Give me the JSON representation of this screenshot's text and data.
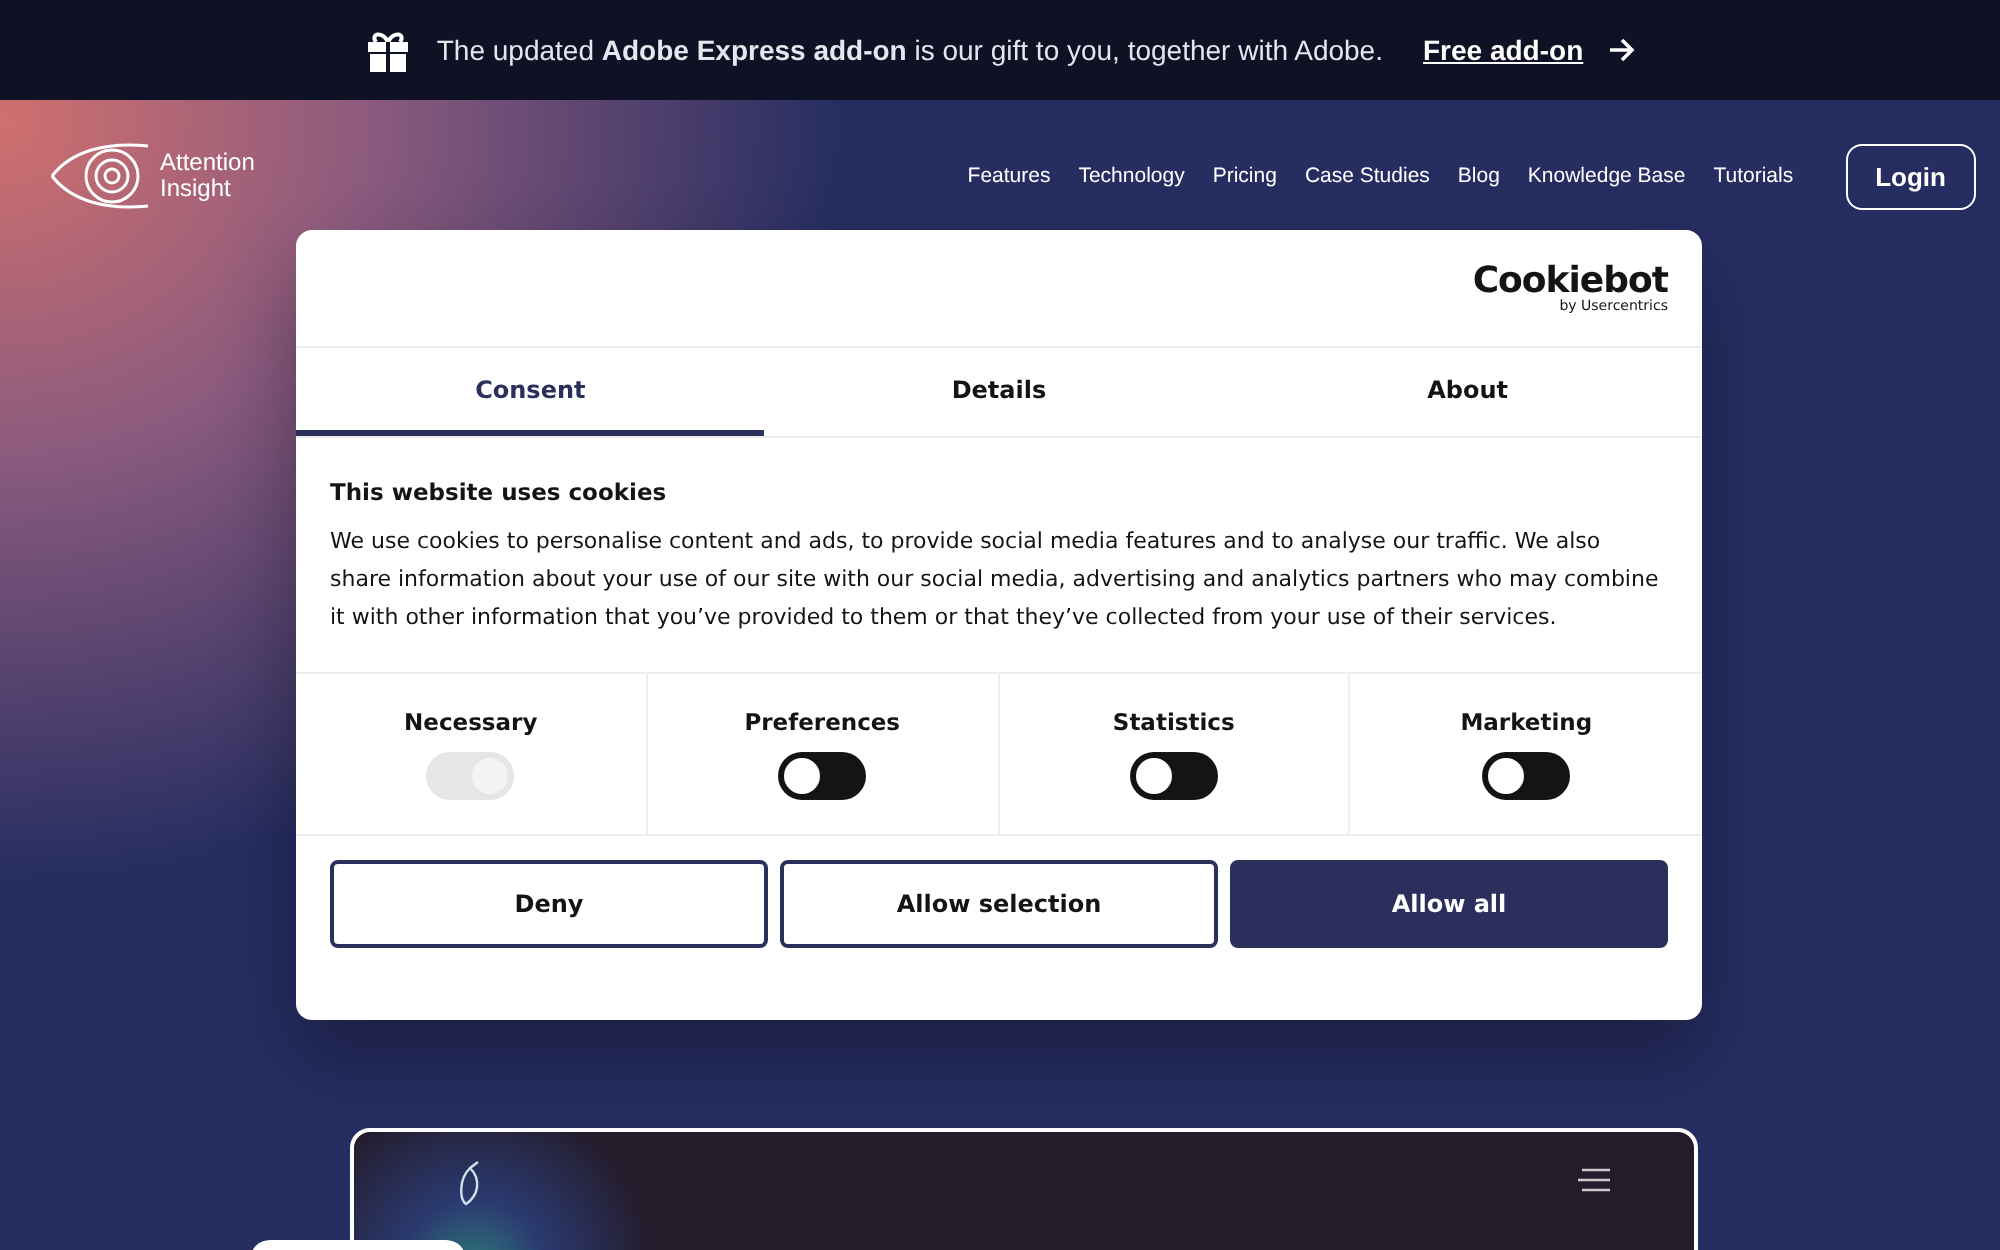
{
  "banner": {
    "text": "The updated **Adobe Express add-on** is our gift to you, together with Adobe.",
    "link": "Free add-on"
  },
  "header": {
    "logo": "Attention Insight",
    "nav": [
      "Features",
      "Technology",
      "Pricing",
      "Case Studies",
      "Blog",
      "Knowledge Base",
      "Tutorials"
    ],
    "login": "Login"
  },
  "cookie_dialog": {
    "brand": "Cookiebot",
    "brand_sub": "by Usercentrics",
    "tabs": [
      {
        "label": "Consent",
        "selected": true
      },
      {
        "label": "Details",
        "selected": false
      },
      {
        "label": "About",
        "selected": false
      }
    ],
    "title": "This website uses cookies",
    "body": "We use cookies to personalise content and ads, to provide social media features and to analyse our traffic. We also share information about your use of our site with our social media, advertising and analytics partners who may combine it with other information that you’ve provided to them or that they’ve collected from your use of their services.",
    "categories": [
      {
        "label": "Necessary",
        "checked": true,
        "disabled": true
      },
      {
        "label": "Preferences",
        "checked": false,
        "disabled": false
      },
      {
        "label": "Statistics",
        "checked": false,
        "disabled": false
      },
      {
        "label": "Marketing",
        "checked": false,
        "disabled": false
      }
    ],
    "buttons": [
      {
        "label": "Deny",
        "kind": "outline"
      },
      {
        "label": "Allow selection",
        "kind": "outline"
      },
      {
        "label": "Allow all",
        "kind": "filled"
      }
    ]
  }
}
